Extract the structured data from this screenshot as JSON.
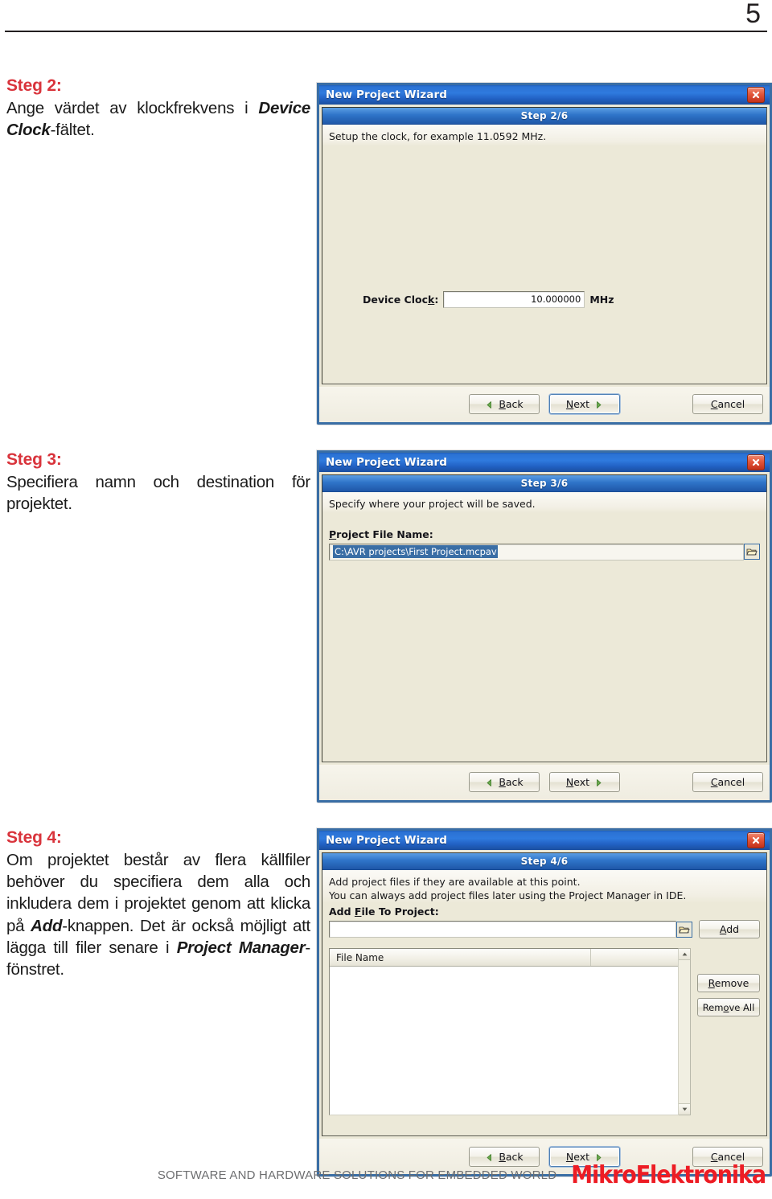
{
  "page": {
    "number": "5",
    "footer_tagline": "SOFTWARE AND HARDWARE SOLUTIONS FOR EMBEDDED WORLD",
    "footer_logo": "MikroElektronika",
    "accent_red": "#d9343c",
    "logo_red": "#ed1c24",
    "titlebar_blue": "#2f7ade",
    "dialog_face": "#ece9d8"
  },
  "instructions": [
    {
      "heading": "Steg 2:",
      "line1_a": "Ange",
      "body_parts": [
        {
          "text": "Ange värdet av klockfrekvens i ",
          "bold": false
        },
        {
          "text": "Device Clock",
          "bold": true
        },
        {
          "text": "-fältet.",
          "bold": false
        }
      ]
    },
    {
      "heading": "Steg 3:",
      "body_parts": [
        {
          "text": "Specifiera namn och destination för projektet.",
          "bold": false
        }
      ]
    },
    {
      "heading": "Steg 4:",
      "body_parts": [
        {
          "text": "Om projektet består av flera källfiler behöver du specifiera dem alla och inkludera dem i projektet genom att klicka på ",
          "bold": false
        },
        {
          "text": "Add",
          "bold": true
        },
        {
          "text": "-knappen. Det är också möjligt att lägga till filer senare i ",
          "bold": false
        },
        {
          "text": "Project Manager",
          "bold": true
        },
        {
          "text": "-fönstret.",
          "bold": false
        }
      ]
    }
  ],
  "dialogs": [
    {
      "title": "New Project Wizard",
      "close_icon": "close-icon",
      "step_label": "Step 2/6",
      "description_lines": [
        "Setup the clock, for example 11.0592 MHz."
      ],
      "device_clock": {
        "label": "Device Clock:",
        "value": "10.000000",
        "unit": "MHz"
      },
      "buttons": {
        "back": "Back",
        "next": "Next",
        "cancel": "Cancel",
        "default": "next"
      }
    },
    {
      "title": "New Project Wizard",
      "close_icon": "close-icon",
      "step_label": "Step 3/6",
      "description_lines": [
        "Specify where your project will be saved."
      ],
      "project_file": {
        "label": "Project File Name:",
        "value": "C:\\AVR projects\\First Project.mcpav",
        "browse_icon": "folder-open-icon",
        "selected": true
      },
      "buttons": {
        "back": "Back",
        "next": "Next",
        "cancel": "Cancel",
        "default": "none"
      }
    },
    {
      "title": "New Project Wizard",
      "close_icon": "close-icon",
      "step_label": "Step 4/6",
      "description_lines": [
        "Add project files if they are available at this point.",
        "You can always add project files later using the Project Manager in IDE."
      ],
      "add_file": {
        "label": "Add File To Project:",
        "value": "",
        "placeholder": "",
        "browse_icon": "folder-open-icon",
        "add_button": "Add"
      },
      "file_list": {
        "columns": [
          "File Name",
          ""
        ],
        "rows": []
      },
      "side_buttons": {
        "remove": "Remove",
        "remove_all": "Remove All"
      },
      "buttons": {
        "back": "Back",
        "next": "Next",
        "cancel": "Cancel",
        "default": "next"
      }
    }
  ]
}
